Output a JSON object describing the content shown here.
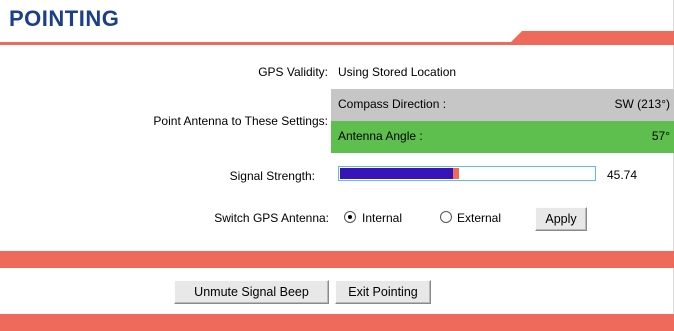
{
  "page": {
    "title": "POINTING",
    "accent_color": "#ef6a5a",
    "title_color": "#1c3f8c"
  },
  "gps_validity": {
    "label": "GPS Validity:",
    "value": "Using Stored Location"
  },
  "point_antenna": {
    "label": "Point Antenna to These Settings:",
    "compass_label": "Compass Direction :",
    "compass_value": "SW (213°)",
    "angle_label": "Antenna Angle :",
    "angle_value": "57°",
    "compass_bg": "#c6c6c6",
    "angle_bg": "#5fbf4e"
  },
  "signal": {
    "label": "Signal Strength:",
    "value": "45.74",
    "fill_fraction": 0.47,
    "fill_color": "#3713b8"
  },
  "gps_antenna": {
    "label": "Switch GPS Antenna:",
    "options": [
      "Internal",
      "External"
    ],
    "selected": "Internal",
    "apply_label": "Apply"
  },
  "actions": {
    "unmute_label": "Unmute Signal Beep",
    "exit_label": "Exit Pointing"
  }
}
